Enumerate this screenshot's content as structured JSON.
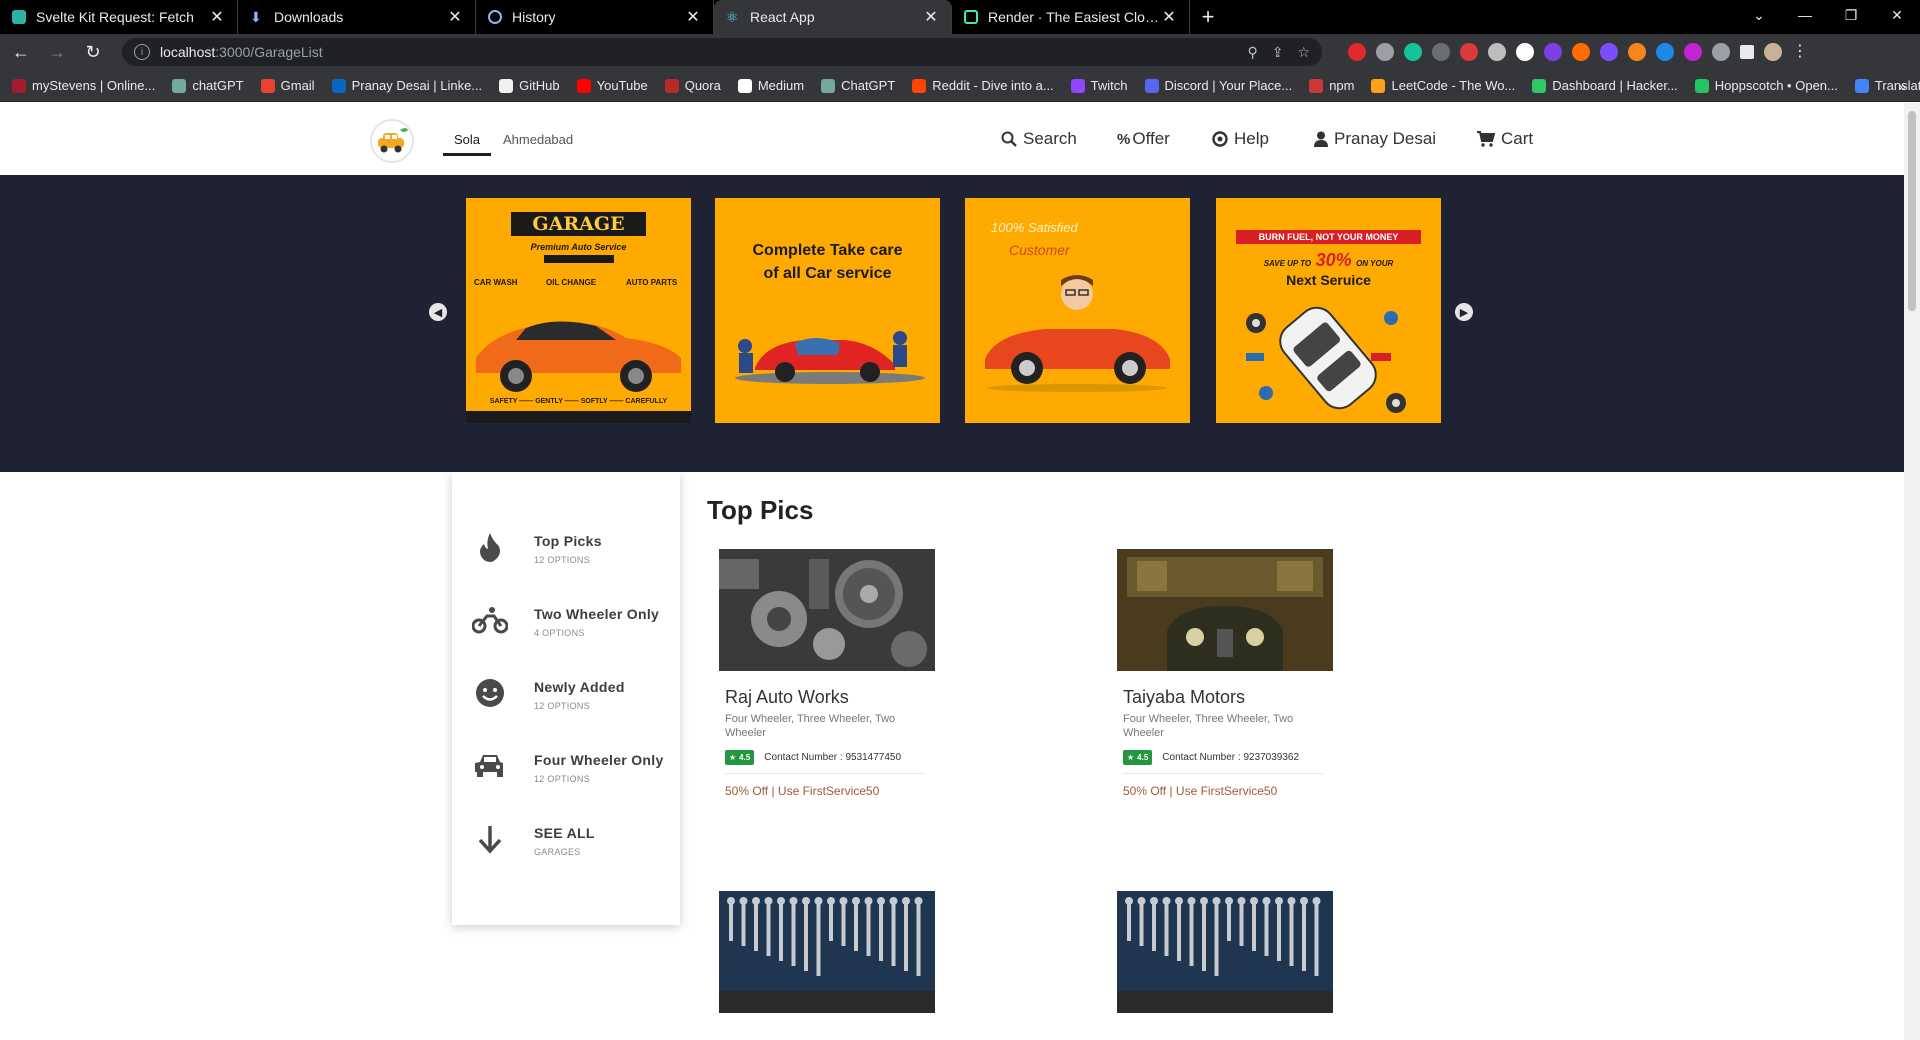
{
  "browser": {
    "tabs": [
      {
        "title": "Svelte Kit Request: Fetch",
        "color": "#2bb3a3"
      },
      {
        "title": "Downloads",
        "color": "#8ab4f8"
      },
      {
        "title": "History",
        "color": "#8ab4f8"
      },
      {
        "title": "React App",
        "color": "#61dafb"
      },
      {
        "title": "Render · The Easiest Cloud For All",
        "color": "#46e3b7"
      }
    ],
    "url_host": "localhost",
    "url_path": ":3000/GarageList",
    "bookmarks": [
      {
        "label": "myStevens | Online...",
        "color": "#a51c30"
      },
      {
        "label": "chatGPT",
        "color": "#74aa9c"
      },
      {
        "label": "Gmail",
        "color": "#ea4335"
      },
      {
        "label": "Pranay Desai | Linke...",
        "color": "#0a66c2"
      },
      {
        "label": "GitHub",
        "color": "#f0f0f0"
      },
      {
        "label": "YouTube",
        "color": "#ff0000"
      },
      {
        "label": "Quora",
        "color": "#b92b27"
      },
      {
        "label": "Medium",
        "color": "#ffffff"
      },
      {
        "label": "ChatGPT",
        "color": "#74aa9c"
      },
      {
        "label": "Reddit - Dive into a...",
        "color": "#ff4500"
      },
      {
        "label": "Twitch",
        "color": "#9146ff"
      },
      {
        "label": "Discord | Your Place...",
        "color": "#5865f2"
      },
      {
        "label": "npm",
        "color": "#cb3837"
      },
      {
        "label": "LeetCode - The Wo...",
        "color": "#ffa116"
      },
      {
        "label": "Dashboard | Hacker...",
        "color": "#2ec866"
      },
      {
        "label": "Hoppscotch • Open...",
        "color": "#22c55e"
      },
      {
        "label": "Translate",
        "color": "#4285f4"
      }
    ]
  },
  "site": {
    "locations": [
      "Sola",
      "Ahmedabad"
    ],
    "nav": {
      "search": "Search",
      "offer": "Offer",
      "help": "Help",
      "user": "Pranay Desai",
      "cart": "Cart"
    },
    "banners": {
      "b1_title": "GARAGE",
      "b1_subtitle": "Premium Auto Service",
      "b1_car_wash": "CAR WASH",
      "b1_oil_change": "OIL CHANGE",
      "b1_auto_parts": "AUTO PARTS",
      "b1_footer": "SAFETY —— GENTLY —— SOFTLY —— CAREFULLY",
      "b2_line1": "Complete Take care",
      "b2_line2": "of all Car service",
      "b3_line1": "100% Satisfied",
      "b3_line2": "Customer",
      "b4_ribbon": "BURN FUEL, NOT YOUR MONEY",
      "b4_save_pre": "SAVE UP TO",
      "b4_percent": "30%",
      "b4_save_post": "ON YOUR",
      "b4_next": "Next Seruice"
    },
    "sidebar": [
      {
        "title": "Top Picks",
        "sub": "12 OPTIONS",
        "icon": "fire-icon"
      },
      {
        "title": "Two Wheeler Only",
        "sub": "4 OPTIONS",
        "icon": "bicycle-icon"
      },
      {
        "title": "Newly Added",
        "sub": "12 OPTIONS",
        "icon": "smile-icon"
      },
      {
        "title": "Four Wheeler Only",
        "sub": "12 OPTIONS",
        "icon": "car-icon"
      },
      {
        "title": "SEE ALL",
        "sub": "GARAGES",
        "icon": "arrow-down-icon"
      }
    ],
    "main_title": "Top Pics",
    "garages": [
      {
        "name": "Raj Auto Works",
        "types": "Four Wheeler, Three Wheeler, Two Wheeler",
        "rating": "4.5",
        "contact": "Contact Number : 9531477450",
        "offer": "50% Off | Use FirstService50"
      },
      {
        "name": "Taiyaba Motors",
        "types": "Four Wheeler, Three Wheeler, Two Wheeler",
        "rating": "4.5",
        "contact": "Contact Number : 9237039362",
        "offer": "50% Off | Use FirstService50"
      }
    ],
    "colors": {
      "hero_bg": "#1e2232",
      "banner_bg": "#ffaa00",
      "rating_green": "#24963f",
      "offer_text": "#a05a3c"
    }
  }
}
